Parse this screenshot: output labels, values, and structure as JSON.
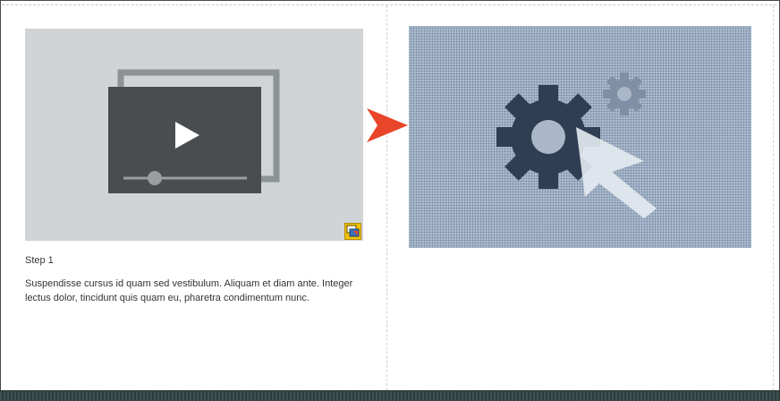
{
  "step": {
    "title": "Step 1",
    "description": "Suspendisse cursus id quam sed vestibulum. Aliquam et diam ante. Integer lectus dolor, tincidunt quis quam eu, pharetra condimentum nunc."
  },
  "icons": {
    "video": "video-playlist-icon",
    "arrow": "next-arrow-icon",
    "settings": "settings-gear-cursor-icon",
    "resize": "image-resize-handle-icon"
  },
  "colors": {
    "video_bg": "#d0d4d6",
    "video_dark": "#4a4d4f",
    "arrow": "#e8452a",
    "settings_bg": "#a9b7c9",
    "gear_dark": "#2f3e52",
    "gear_light": "#8a9ab0",
    "handle": "#f2c200"
  }
}
